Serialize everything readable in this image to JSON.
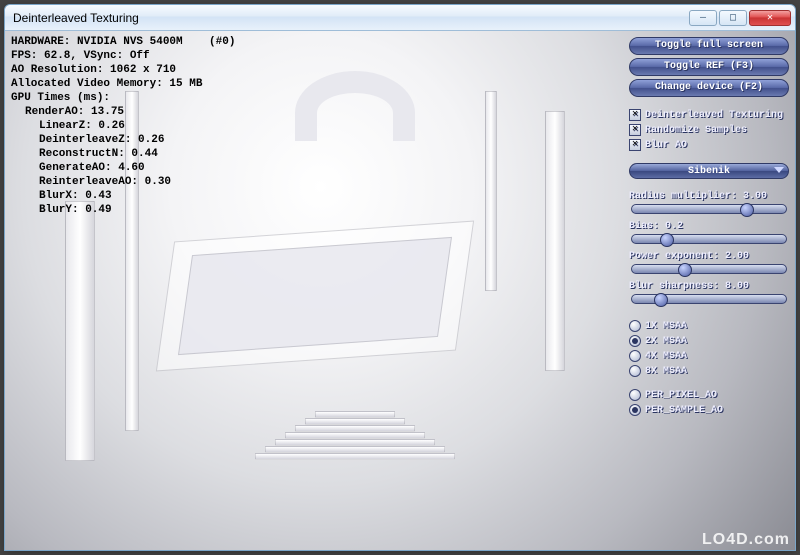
{
  "window": {
    "title": "Deinterleaved Texturing",
    "buttons": {
      "min": "—",
      "max": "□",
      "close": "✕"
    }
  },
  "overlay": {
    "hardware": "HARDWARE: NVIDIA NVS 5400M    (#0)",
    "fps": "FPS: 62.8, VSync: Off",
    "ao_res": "AO Resolution: 1062 x 710",
    "mem": "Allocated Video Memory: 15 MB",
    "gpu_header": "GPU Times (ms):",
    "render_ao": "RenderAO: 13.75",
    "linear_z": "LinearZ: 0.26",
    "deinterleave_z": "DeinterleaveZ: 0.26",
    "reconstruct_n": "ReconstructN: 0.44",
    "generate_ao": "GenerateAO: 4.60",
    "reinterleave_ao": "ReinterleaveAO: 0.30",
    "blur_x": "BlurX: 0.43",
    "blur_y": "BlurY: 0.49"
  },
  "panel": {
    "buttons": {
      "fullscreen": "Toggle full screen",
      "ref": "Toggle REF (F3)",
      "device": "Change device (F2)"
    },
    "checks": {
      "deint": "Deinterleaved Texturing",
      "randomize": "Randomize Samples",
      "blur": "Blur AO"
    },
    "dropdown": {
      "selected": "Sibenik"
    },
    "sliders": {
      "radius": {
        "label": "Radius multiplier: 3.00",
        "pos": 70
      },
      "bias": {
        "label": "Bias: 0.2",
        "pos": 18
      },
      "power": {
        "label": "Power exponent: 2.00",
        "pos": 30
      },
      "sharp": {
        "label": "Blur sharpness: 8.00",
        "pos": 14
      }
    },
    "msaa": {
      "x1": "1X MSAA",
      "x2": "2X MSAA",
      "x4": "4X MSAA",
      "x8": "8X MSAA",
      "selected": "x2"
    },
    "ao_mode": {
      "pixel": "PER_PIXEL_AO",
      "sample": "PER_SAMPLE_AO",
      "selected": "sample"
    }
  },
  "watermark": "LO4D.com"
}
